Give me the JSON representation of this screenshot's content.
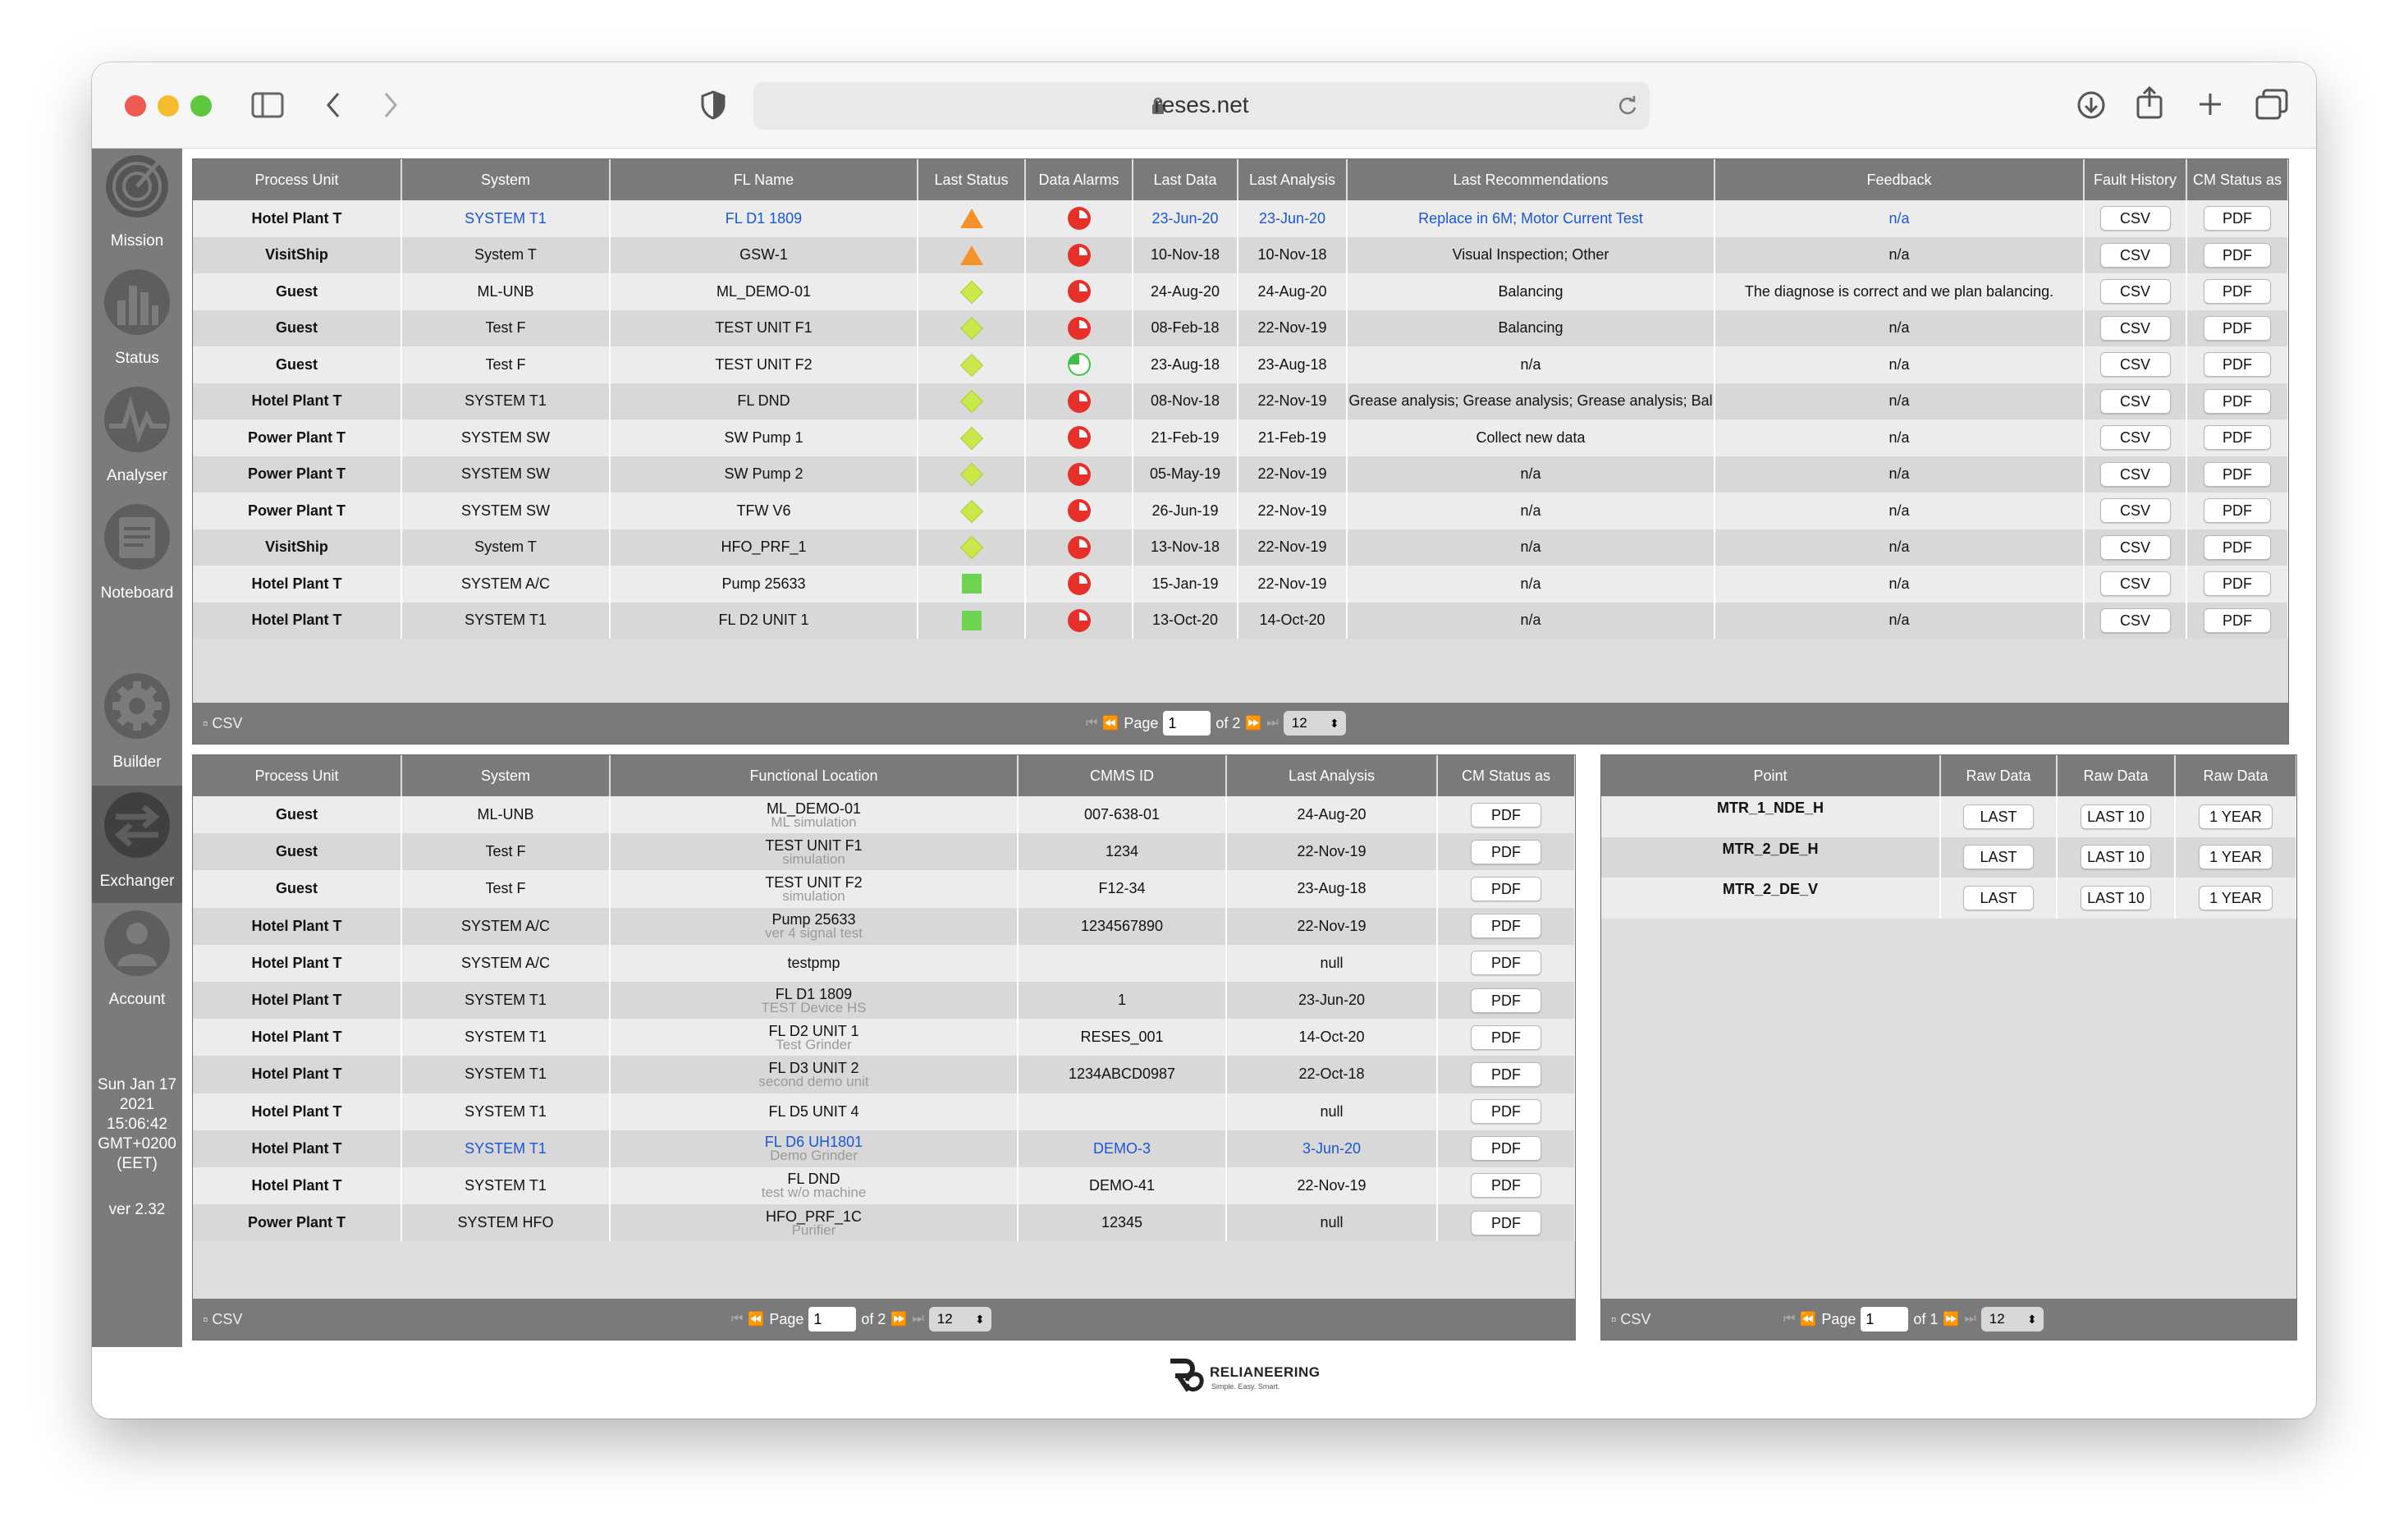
{
  "browser": {
    "url": "reses.net"
  },
  "sidebar": {
    "items": [
      {
        "label": "Mission",
        "icon": "mission-icon"
      },
      {
        "label": "Status",
        "icon": "status-bars-icon"
      },
      {
        "label": "Analyser",
        "icon": "analyser-icon"
      },
      {
        "label": "Noteboard",
        "icon": "noteboard-icon"
      },
      {
        "label": "Builder",
        "icon": "gear-icon"
      },
      {
        "label": "Exchanger",
        "icon": "exchange-arrows-icon"
      },
      {
        "label": "Account",
        "icon": "account-icon"
      }
    ],
    "datetime": [
      "Sun Jan 17",
      "2021",
      "15:06:42",
      "GMT+0200",
      "(EET)"
    ],
    "version": "ver 2.32"
  },
  "status_table": {
    "headers": [
      "Process Unit",
      "System",
      "FL Name",
      "Last Status",
      "Data Alarms",
      "Last Data",
      "Last Analysis",
      "Last Recommendations",
      "Feedback",
      "Fault History",
      "CM Status as"
    ],
    "rows": [
      {
        "unit": "Hotel Plant T",
        "system": "SYSTEM T1",
        "fl": "FL D1 1809",
        "status": "triangle",
        "alarm": "red",
        "last_data": "23-Jun-20",
        "last_analysis": "23-Jun-20",
        "rec": "Replace in 6M; Motor Current Test",
        "feedback": "n/a",
        "highlight": true
      },
      {
        "unit": "VisitShip",
        "system": "System T",
        "fl": "GSW-1",
        "status": "triangle",
        "alarm": "red",
        "last_data": "10-Nov-18",
        "last_analysis": "10-Nov-18",
        "rec": "Visual Inspection; Other",
        "feedback": "n/a"
      },
      {
        "unit": "Guest",
        "system": "ML-UNB",
        "fl": "ML_DEMO-01",
        "status": "diamond",
        "alarm": "red",
        "last_data": "24-Aug-20",
        "last_analysis": "24-Aug-20",
        "rec": "Balancing",
        "feedback": "The diagnose is correct and we plan balancing."
      },
      {
        "unit": "Guest",
        "system": "Test F",
        "fl": "TEST UNIT F1",
        "status": "diamond",
        "alarm": "red",
        "last_data": "08-Feb-18",
        "last_analysis": "22-Nov-19",
        "rec": "Balancing",
        "feedback": "n/a"
      },
      {
        "unit": "Guest",
        "system": "Test F",
        "fl": "TEST UNIT F2",
        "status": "diamond",
        "alarm": "green",
        "last_data": "23-Aug-18",
        "last_analysis": "23-Aug-18",
        "rec": "n/a",
        "feedback": "n/a"
      },
      {
        "unit": "Hotel Plant T",
        "system": "SYSTEM T1",
        "fl": "FL DND",
        "status": "diamond",
        "alarm": "red",
        "last_data": "08-Nov-18",
        "last_analysis": "22-Nov-19",
        "rec": "Grease analysis; Grease analysis; Grease analysis; Bal",
        "feedback": "n/a"
      },
      {
        "unit": "Power Plant T",
        "system": "SYSTEM SW",
        "fl": "SW Pump 1",
        "status": "diamond",
        "alarm": "red",
        "last_data": "21-Feb-19",
        "last_analysis": "21-Feb-19",
        "rec": "Collect new data",
        "feedback": "n/a"
      },
      {
        "unit": "Power Plant T",
        "system": "SYSTEM SW",
        "fl": "SW Pump 2",
        "status": "diamond",
        "alarm": "red",
        "last_data": "05-May-19",
        "last_analysis": "22-Nov-19",
        "rec": "n/a",
        "feedback": "n/a"
      },
      {
        "unit": "Power Plant T",
        "system": "SYSTEM SW",
        "fl": "TFW  V6",
        "status": "diamond",
        "alarm": "red",
        "last_data": "26-Jun-19",
        "last_analysis": "22-Nov-19",
        "rec": "n/a",
        "feedback": "n/a"
      },
      {
        "unit": "VisitShip",
        "system": "System T",
        "fl": "HFO_PRF_1",
        "status": "diamond",
        "alarm": "red",
        "last_data": "13-Nov-18",
        "last_analysis": "22-Nov-19",
        "rec": "n/a",
        "feedback": "n/a"
      },
      {
        "unit": "Hotel Plant T",
        "system": "SYSTEM A/C",
        "fl": "Pump 25633",
        "status": "square",
        "alarm": "red",
        "last_data": "15-Jan-19",
        "last_analysis": "22-Nov-19",
        "rec": "n/a",
        "feedback": "n/a"
      },
      {
        "unit": "Hotel Plant T",
        "system": "SYSTEM T1",
        "fl": "FL D2 UNIT 1",
        "status": "square",
        "alarm": "red",
        "last_data": "13-Oct-20",
        "last_analysis": "14-Oct-20",
        "rec": "n/a",
        "feedback": "n/a"
      }
    ],
    "csv_btn": "CSV",
    "pdf_btn": "PDF",
    "footer": {
      "csv": "CSV",
      "page_label": "Page",
      "page": "1",
      "of": "of 2",
      "per_page": "12"
    }
  },
  "fl_table": {
    "headers": [
      "Process Unit",
      "System",
      "Functional Location",
      "CMMS ID",
      "Last Analysis",
      "CM Status as"
    ],
    "rows": [
      {
        "unit": "Guest",
        "system": "ML-UNB",
        "fl": "ML_DEMO-01",
        "sub": "ML simulation",
        "cmms": "007-638-01",
        "last": "24-Aug-20"
      },
      {
        "unit": "Guest",
        "system": "Test F",
        "fl": "TEST UNIT F1",
        "sub": "simulation",
        "cmms": "1234",
        "last": "22-Nov-19"
      },
      {
        "unit": "Guest",
        "system": "Test F",
        "fl": "TEST UNIT F2",
        "sub": "simulation",
        "cmms": "F12-34",
        "last": "23-Aug-18"
      },
      {
        "unit": "Hotel Plant T",
        "system": "SYSTEM A/C",
        "fl": "Pump 25633",
        "sub": "ver 4 signal test",
        "cmms": "1234567890",
        "last": "22-Nov-19"
      },
      {
        "unit": "Hotel Plant T",
        "system": "SYSTEM A/C",
        "fl": "testpmp",
        "sub": "",
        "cmms": "",
        "last": "null"
      },
      {
        "unit": "Hotel Plant T",
        "system": "SYSTEM T1",
        "fl": "FL D1 1809",
        "sub": "TEST Device HS",
        "cmms": "1",
        "last": "23-Jun-20"
      },
      {
        "unit": "Hotel Plant T",
        "system": "SYSTEM T1",
        "fl": "FL D2 UNIT 1",
        "sub": "Test Grinder",
        "cmms": "RESES_001",
        "last": "14-Oct-20"
      },
      {
        "unit": "Hotel Plant T",
        "system": "SYSTEM T1",
        "fl": "FL D3 UNIT 2",
        "sub": "second demo unit",
        "cmms": "1234ABCD0987",
        "last": "22-Oct-18"
      },
      {
        "unit": "Hotel Plant T",
        "system": "SYSTEM T1",
        "fl": "FL D5 UNIT 4",
        "sub": "",
        "cmms": "",
        "last": "null"
      },
      {
        "unit": "Hotel Plant T",
        "system": "SYSTEM T1",
        "fl": "FL D6 UH1801",
        "sub": "Demo Grinder",
        "cmms": "DEMO-3",
        "last": "3-Jun-20",
        "highlight": true
      },
      {
        "unit": "Hotel Plant T",
        "system": "SYSTEM T1",
        "fl": "FL DND",
        "sub": "test w/o machine",
        "cmms": "DEMO-41",
        "last": "22-Nov-19"
      },
      {
        "unit": "Power Plant T",
        "system": "SYSTEM HFO",
        "fl": "HFO_PRF_1C",
        "sub": "Purifier",
        "cmms": "12345",
        "last": "null"
      }
    ],
    "pdf_btn": "PDF",
    "footer": {
      "csv": "CSV",
      "page_label": "Page",
      "page": "1",
      "of": "of 2",
      "per_page": "12"
    }
  },
  "point_table": {
    "headers": [
      "Point",
      "Raw Data",
      "Raw Data",
      "Raw Data"
    ],
    "rows": [
      {
        "point": "MTR_1_NDE_H"
      },
      {
        "point": "MTR_2_DE_H"
      },
      {
        "point": "MTR_2_DE_V"
      }
    ],
    "btn_last": "LAST",
    "btn_last10": "LAST 10",
    "btn_year": "1 YEAR",
    "footer": {
      "csv": "CSV",
      "page_label": "Page",
      "page": "1",
      "of": "of 1",
      "per_page": "12"
    }
  },
  "brand": {
    "name": "RELIANEERING",
    "tagline": "Simple. Easy. Smart."
  },
  "colors": {
    "link": "#1a56d6",
    "alarm_red": "#e8302a",
    "alarm_green": "#3fbf4a",
    "triangle": "#f5922a",
    "diamond": "#c8e84c",
    "square": "#6cd450"
  }
}
